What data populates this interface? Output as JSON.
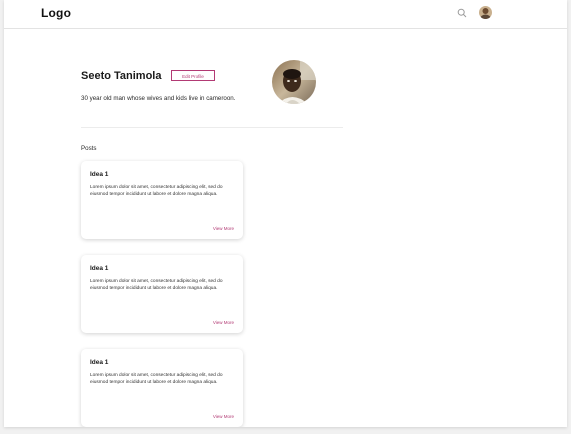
{
  "header": {
    "logo": "Logo",
    "search_icon": "search-icon",
    "avatar_icon": "user-avatar"
  },
  "profile": {
    "name": "Seeto Tanimola",
    "edit_button_label": "Edit Profile",
    "bio": "30 year old man whose wives and kids live in cameroon."
  },
  "posts": {
    "heading": "Posts",
    "items": [
      {
        "title": "Idea 1",
        "body": "Lorem ipsum dolor sit amet, consectetur adipiscing elit, sed do eiusmod tempor incididunt ut labore et dolore magna aliqua.",
        "link": "View More"
      },
      {
        "title": "Idea 1",
        "body": "Lorem ipsum dolor sit amet, consectetur adipiscing elit, sed do eiusmod tempor incididunt ut labore et dolore magna aliqua.",
        "link": "View More"
      },
      {
        "title": "Idea 1",
        "body": "Lorem ipsum dolor sit amet, consectetur adipiscing elit, sed do eiusmod tempor incididunt ut labore et dolore magna aliqua.",
        "link": "View More"
      }
    ]
  },
  "colors": {
    "accent": "#b23a74",
    "background": "#ffffff",
    "text": "#1e1e1e"
  }
}
